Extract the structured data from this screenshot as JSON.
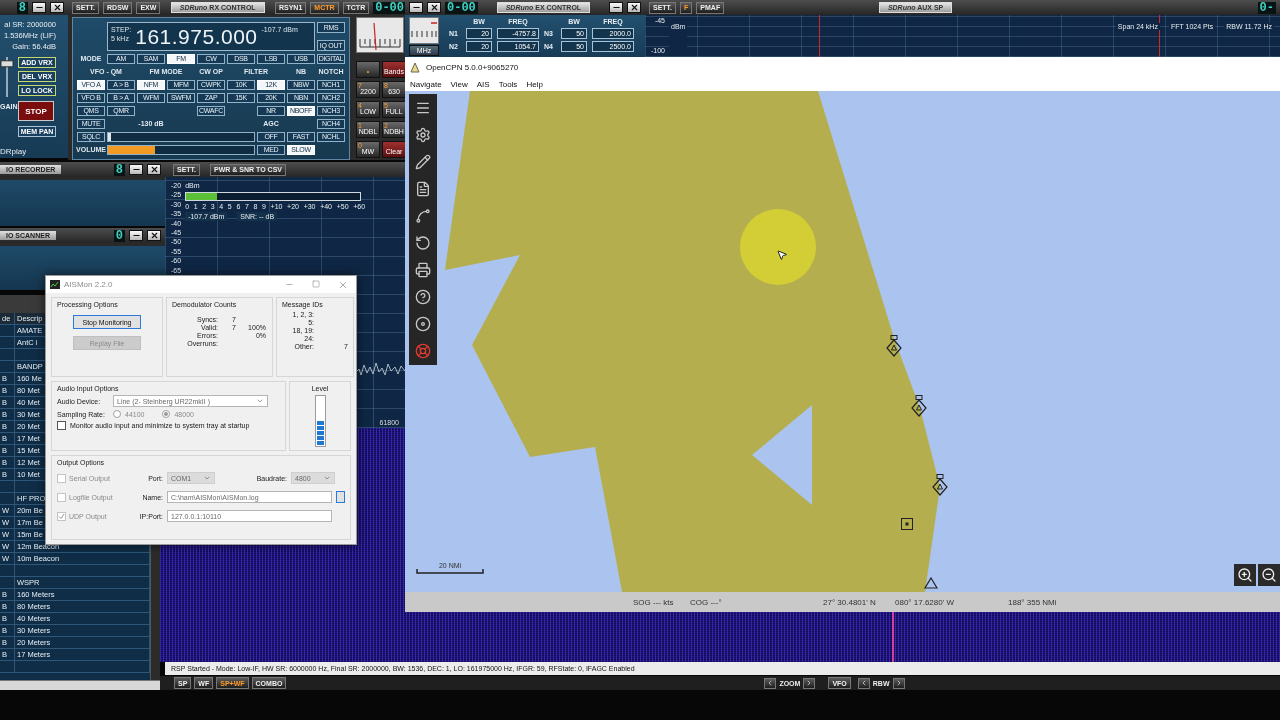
{
  "sdr_main": {
    "digit": "8",
    "info": [
      "al SR: 2000000",
      "1.536MHz (LIF)",
      "Gain: 56.4dB"
    ],
    "vrx_buttons": [
      "ADD VRX",
      "DEL VRX",
      "LO LOCK"
    ],
    "gain": {
      "label": "GAIN",
      "level": 0.9
    },
    "stop_button": "STOP",
    "mem_button": "MEM PAN",
    "brand": "DRplay"
  },
  "rx_control": {
    "left_buttons": [
      "SETT.",
      "RDSW",
      "EXW"
    ],
    "title": "*SDRuno* RX CONTROL",
    "right_buttons": [
      {
        "label": "RSYN1",
        "selected": false
      },
      {
        "label": "MCTR",
        "selected": true
      },
      {
        "label": "TCTR",
        "selected": false
      }
    ],
    "digits": "0-00",
    "step_label": "STEP:",
    "step": "5 kHz",
    "frequency": "161.975.000",
    "signal": "-107.7 dBm",
    "side_buttons": [
      {
        "label": "RMS",
        "selected": false
      },
      {
        "label": "IQ OUT",
        "selected": false
      }
    ],
    "mode_label": "MODE",
    "modes": [
      {
        "label": "AM",
        "selected": false
      },
      {
        "label": "SAM",
        "selected": false
      },
      {
        "label": "FM",
        "selected": true
      },
      {
        "label": "CW",
        "selected": false
      },
      {
        "label": "DSB",
        "selected": false
      },
      {
        "label": "LSB",
        "selected": false
      },
      {
        "label": "USB",
        "selected": false
      }
    ],
    "digital": {
      "label": "DIGITAL",
      "selected": false
    },
    "group_labels": [
      "VFO - QM",
      "FM MODE",
      "CW OP",
      "FILTER",
      "NB",
      "NOTCH"
    ],
    "buttons": [
      {
        "label": "VFO A",
        "selected": true
      },
      {
        "label": "A > B",
        "selected": false
      },
      {
        "label": "NFM",
        "selected": true
      },
      {
        "label": "MFM",
        "selected": false
      },
      {
        "label": "CWPK",
        "selected": false
      },
      {
        "label": "10K",
        "selected": false
      },
      {
        "label": "12K",
        "selected": true
      },
      {
        "label": "NBW",
        "selected": false
      },
      {
        "label": "NCH1",
        "selected": false
      },
      {
        "label": "VFO B",
        "selected": false
      },
      {
        "label": "B > A",
        "selected": false
      },
      {
        "label": "WFM",
        "selected": false
      },
      {
        "label": "SWFM",
        "selected": false
      },
      {
        "label": "ZAP",
        "selected": false
      },
      {
        "label": "15K",
        "selected": false
      },
      {
        "label": "20K",
        "selected": false
      },
      {
        "label": "NBN",
        "selected": false
      },
      {
        "label": "NCH2",
        "selected": false
      },
      {
        "label": "QMS",
        "selected": false
      },
      {
        "label": "QMR",
        "selected": false
      },
      {
        "label": "CWAFC",
        "selected": false
      },
      {
        "label": "NR",
        "selected": false
      },
      {
        "label": "NBOFF",
        "selected": true
      },
      {
        "label": "NCH3",
        "selected": false
      },
      {
        "label": "MUTE",
        "selected": false
      },
      {
        "label": "NCH4",
        "selected": false
      },
      {
        "label": "SQLC",
        "selected": false
      },
      {
        "label": "OFF",
        "selected": false
      },
      {
        "label": "FAST",
        "selected": false
      },
      {
        "label": "NCHL",
        "selected": false
      },
      {
        "label": "MED",
        "selected": false
      },
      {
        "label": "SLOW",
        "selected": true
      }
    ],
    "squelch": {
      "label": "-130 dB",
      "level": 0
    },
    "agc_label": "AGC",
    "volume": {
      "label": "VOLUME",
      "level": 0.32
    }
  },
  "bands": [
    {
      "label": "•",
      "kind": "dot"
    },
    {
      "label": "Bands",
      "kind": "red"
    },
    {
      "hotkey": "7",
      "label": "2200",
      "kind": "normal"
    },
    {
      "hotkey": "8",
      "label": "630",
      "kind": "normal"
    },
    {
      "hotkey": "4",
      "label": "LOW",
      "kind": "normal"
    },
    {
      "hotkey": "5",
      "label": "FULL",
      "kind": "normal"
    },
    {
      "hotkey": "1",
      "label": "NDBL",
      "kind": "normal"
    },
    {
      "hotkey": "2",
      "label": "NDBH",
      "kind": "normal"
    },
    {
      "hotkey": "0",
      "label": "MW",
      "kind": "normal"
    },
    {
      "label": "Clear",
      "kind": "red"
    }
  ],
  "ex_control": {
    "digits": "0-00",
    "title": "*SDRuno* EX CONTROL",
    "mhz_button": "MHz",
    "columns": [
      "",
      "BW",
      "FREQ",
      "",
      "BW",
      "FREQ"
    ],
    "rows": [
      [
        "N1",
        "20",
        "-4757.8",
        "N3",
        "50",
        "2000.0"
      ],
      [
        "N2",
        "20",
        "1054.7",
        "N4",
        "50",
        "2500.0"
      ]
    ]
  },
  "aux_sp": {
    "buttons": [
      {
        "label": "SETT.",
        "selected": false
      },
      {
        "label": "F",
        "selected": true
      },
      {
        "label": "PMAF",
        "selected": false
      }
    ],
    "title": "*SDRuno* AUX SP",
    "digits": "0-",
    "unit": "dBm",
    "yticks": [
      "-45",
      "-100"
    ],
    "readouts": [
      "Span 24 kHz",
      "FFT 1024 Pts",
      "RBW 11.72 Hz"
    ]
  },
  "recorder": {
    "label": "IO RECORDER",
    "digit": "8"
  },
  "scanner": {
    "label": "IO SCANNER",
    "digit": "0"
  },
  "power_meter": {
    "buttons": [
      "SETT.",
      "PWR & SNR TO CSV"
    ],
    "yticks": [
      "-20",
      "-25",
      "-30",
      "-35",
      "-40",
      "-45",
      "-50",
      "-55",
      "-60",
      "-65"
    ],
    "unit": "dBm",
    "level": 0.18,
    "scale": [
      "0",
      "1",
      "2",
      "3",
      "4",
      "5",
      "6",
      "7",
      "8",
      "9",
      "+10",
      "+20",
      "+30",
      "+40",
      "+50",
      "+60"
    ],
    "power": "-107.7 dBm",
    "snr": "SNR: -- dB",
    "freq_label": "61800"
  },
  "memory_list": {
    "columns": [
      "de",
      "Descrip"
    ],
    "rows": [
      {
        "description": "AMATE"
      },
      {
        "description": "AntC i"
      },
      {},
      {
        "description": "BANDP"
      },
      {
        "mode": "B",
        "description": "160 Me"
      },
      {
        "mode": "B",
        "description": "80 Met"
      },
      {
        "mode": "B",
        "description": "40 Met"
      },
      {
        "mode": "B",
        "description": "30 Met"
      },
      {
        "mode": "B",
        "description": "20 Met"
      },
      {
        "mode": "B",
        "description": "17 Met"
      },
      {
        "mode": "B",
        "description": "15 Met"
      },
      {
        "mode": "B",
        "description": "12 Met"
      },
      {
        "mode": "B",
        "description": "10 Met"
      },
      {},
      {
        "description": "HF PRO"
      },
      {
        "mode": "W",
        "description": "20m Be"
      },
      {
        "mode": "W",
        "description": "17m Be"
      },
      {
        "mode": "W",
        "description": "15m Be"
      },
      {
        "mode": "W",
        "description": "12m Beacon"
      },
      {
        "mode": "W",
        "description": "10m Beacon"
      },
      {},
      {
        "description": "WSPR"
      },
      {
        "mode": "B",
        "description": "160 Meters"
      },
      {
        "mode": "B",
        "description": "80 Meters"
      },
      {
        "mode": "B",
        "description": "40 Meters"
      },
      {
        "mode": "B",
        "description": "30 Meters"
      },
      {
        "mode": "B",
        "description": "20 Meters"
      },
      {
        "mode": "B",
        "description": "17 Meters"
      },
      {}
    ]
  },
  "aismon": {
    "title": "AISMon 2.2.0",
    "processing": {
      "title": "Processing Options",
      "stop_button": "Stop Monitoring",
      "replay_button": {
        "label": "Replay File",
        "disabled": true
      }
    },
    "demodulator": {
      "title": "Demodulator Counts",
      "rows": [
        {
          "label": "Syncs:",
          "count": "7"
        },
        {
          "label": "Valid:",
          "count": "7",
          "percent": "100%"
        },
        {
          "label": "Errors:",
          "percent": "0%"
        },
        {
          "label": "Overruns:"
        }
      ]
    },
    "message_ids": {
      "title": "Message IDs",
      "rows": [
        {
          "label": "1, 2, 3:"
        },
        {
          "label": "5:"
        },
        {
          "label": "18, 19:"
        },
        {
          "label": "24:"
        },
        {
          "label": "Other:",
          "count": "7"
        }
      ]
    },
    "audio": {
      "title": "Audio Input Options",
      "device_label": "Audio Device:",
      "device": "Line (2- Steinberg UR22mkII )",
      "rate_label": "Sampling Rate:",
      "rates": [
        {
          "label": "44100",
          "selected": false,
          "disabled": true
        },
        {
          "label": "48000",
          "selected": true,
          "disabled": true
        }
      ],
      "monitor": {
        "label": "Monitor audio input and minimize to system tray at startup",
        "checked": false
      }
    },
    "level": {
      "title": "Level",
      "level": 0.5
    },
    "output": {
      "title": "Output Options",
      "serial": {
        "label": "Serial Output",
        "checked": false,
        "disabled": true
      },
      "port_label": "Port:",
      "port": "COM1",
      "baud_label": "Baudrate:",
      "baud": "4800",
      "logfile": {
        "label": "Logfile Output",
        "checked": false,
        "disabled": true
      },
      "name_label": "Name:",
      "name": "C:\\ham\\AISMon\\AISMon.log",
      "udp": {
        "label": "UDP Output",
        "checked": true,
        "disabled": true
      },
      "ip_label": "IP:Port:",
      "ip": "127.0.0.1:10110"
    }
  },
  "opencpn": {
    "title": "OpenCPN 5.0.0+9065270",
    "menu": [
      "Navigate",
      "View",
      "AIS",
      "Tools",
      "Help"
    ],
    "scale": "20 NMi",
    "status": [
      "SOG --- kts",
      "COG ---°",
      "27° 30.4801' N",
      "080° 17.6280' W",
      "188° 355 NMi"
    ]
  },
  "status_line": "RSP Started - Mode: Low-IF, HW SR: 6000000 Hz, Final SR: 2000000, BW: 1536, DEC: 1, LO: 161975000 Hz, IFGR: 59, RFState: 0, IFAGC Enabled",
  "bottom_bar": {
    "views": [
      {
        "label": "SP",
        "selected": false
      },
      {
        "label": "WF",
        "selected": false
      },
      {
        "label": "SP+WF",
        "selected": true
      },
      {
        "label": "COMBO",
        "selected": false
      }
    ],
    "zoom_label": "ZOOM",
    "vfo_button": "VFO",
    "rbw_label": "RBW"
  }
}
